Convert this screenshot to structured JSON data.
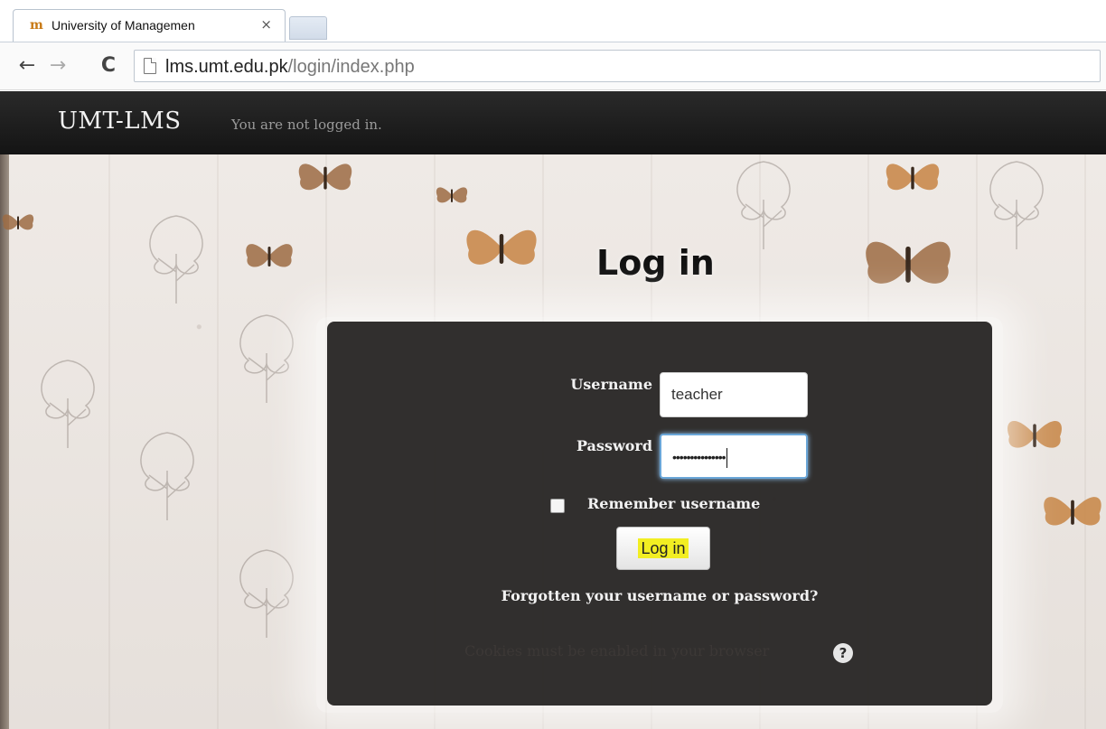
{
  "browser": {
    "tab_title": "University of Managemen",
    "tab_favicon": "moodle-favicon",
    "tab_close": "×",
    "url_host": "lms.umt.edu.pk",
    "url_path": "/login/index.php",
    "icons": {
      "back": "back-arrow-icon",
      "forward": "forward-arrow-icon",
      "reload": "reload-icon",
      "page": "page-icon"
    }
  },
  "navbar": {
    "brand": "UMT-LMS",
    "login_info": "You are not logged in."
  },
  "page": {
    "heading": "Log in"
  },
  "login_form": {
    "username_label": "Username",
    "username_value": "teacher",
    "password_label": "Password",
    "password_value": "•••••••••••••••",
    "remember_label": "Remember username",
    "remember_checked": false,
    "login_button": "Log in",
    "forgot_link": "Forgotten your username or password?",
    "cookies_notice": "Cookies must be enabled in your browser",
    "help_icon": "?"
  },
  "colors": {
    "navbar_bg": "#1c1c1c",
    "panel_bg": "#1c1918",
    "button_highlight": "#f2ee22",
    "favicon": "#c87a16"
  }
}
